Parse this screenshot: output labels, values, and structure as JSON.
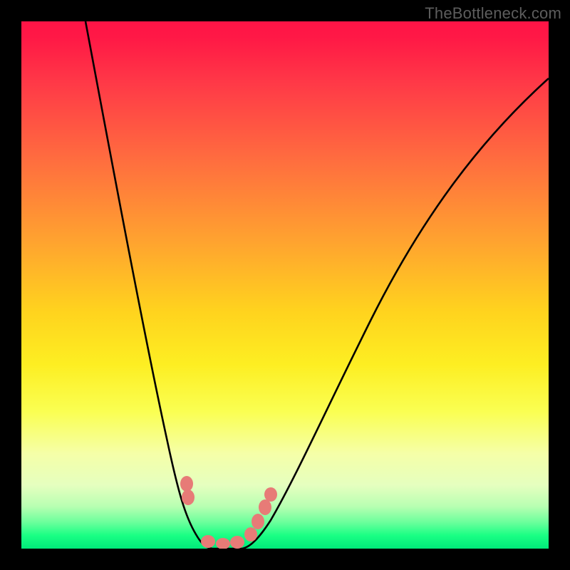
{
  "watermark": "TheBottleneck.com",
  "chart_data": {
    "type": "line",
    "title": "",
    "xlabel": "",
    "ylabel": "",
    "xlim": [
      0,
      100
    ],
    "ylim": [
      0,
      100
    ],
    "background": {
      "style": "vertical-heat-gradient",
      "top_color": "#ff1446",
      "bottom_color": "#00e97a",
      "meaning": "high value (red) at top, optimal/low value (green) at bottom"
    },
    "series": [
      {
        "name": "left-branch",
        "x": [
          12,
          14,
          17,
          20,
          23,
          26,
          28,
          30,
          32,
          34,
          36
        ],
        "y": [
          100,
          88,
          72,
          55,
          40,
          26,
          16,
          10,
          5,
          2,
          0
        ]
      },
      {
        "name": "right-branch",
        "x": [
          42,
          45,
          48,
          53,
          60,
          68,
          78,
          90,
          100
        ],
        "y": [
          0,
          3,
          8,
          18,
          32,
          48,
          65,
          80,
          89
        ]
      }
    ],
    "markers": {
      "name": "highlighted-points",
      "color": "#e77b77",
      "x": [
        31,
        31.5,
        35.5,
        38,
        41,
        43.5,
        45,
        46.3,
        47.3
      ],
      "y": [
        12,
        10,
        1.3,
        0.8,
        1.1,
        2.7,
        5.1,
        7.8,
        10.3
      ]
    },
    "annotations": [],
    "legend": null,
    "grid": false
  }
}
